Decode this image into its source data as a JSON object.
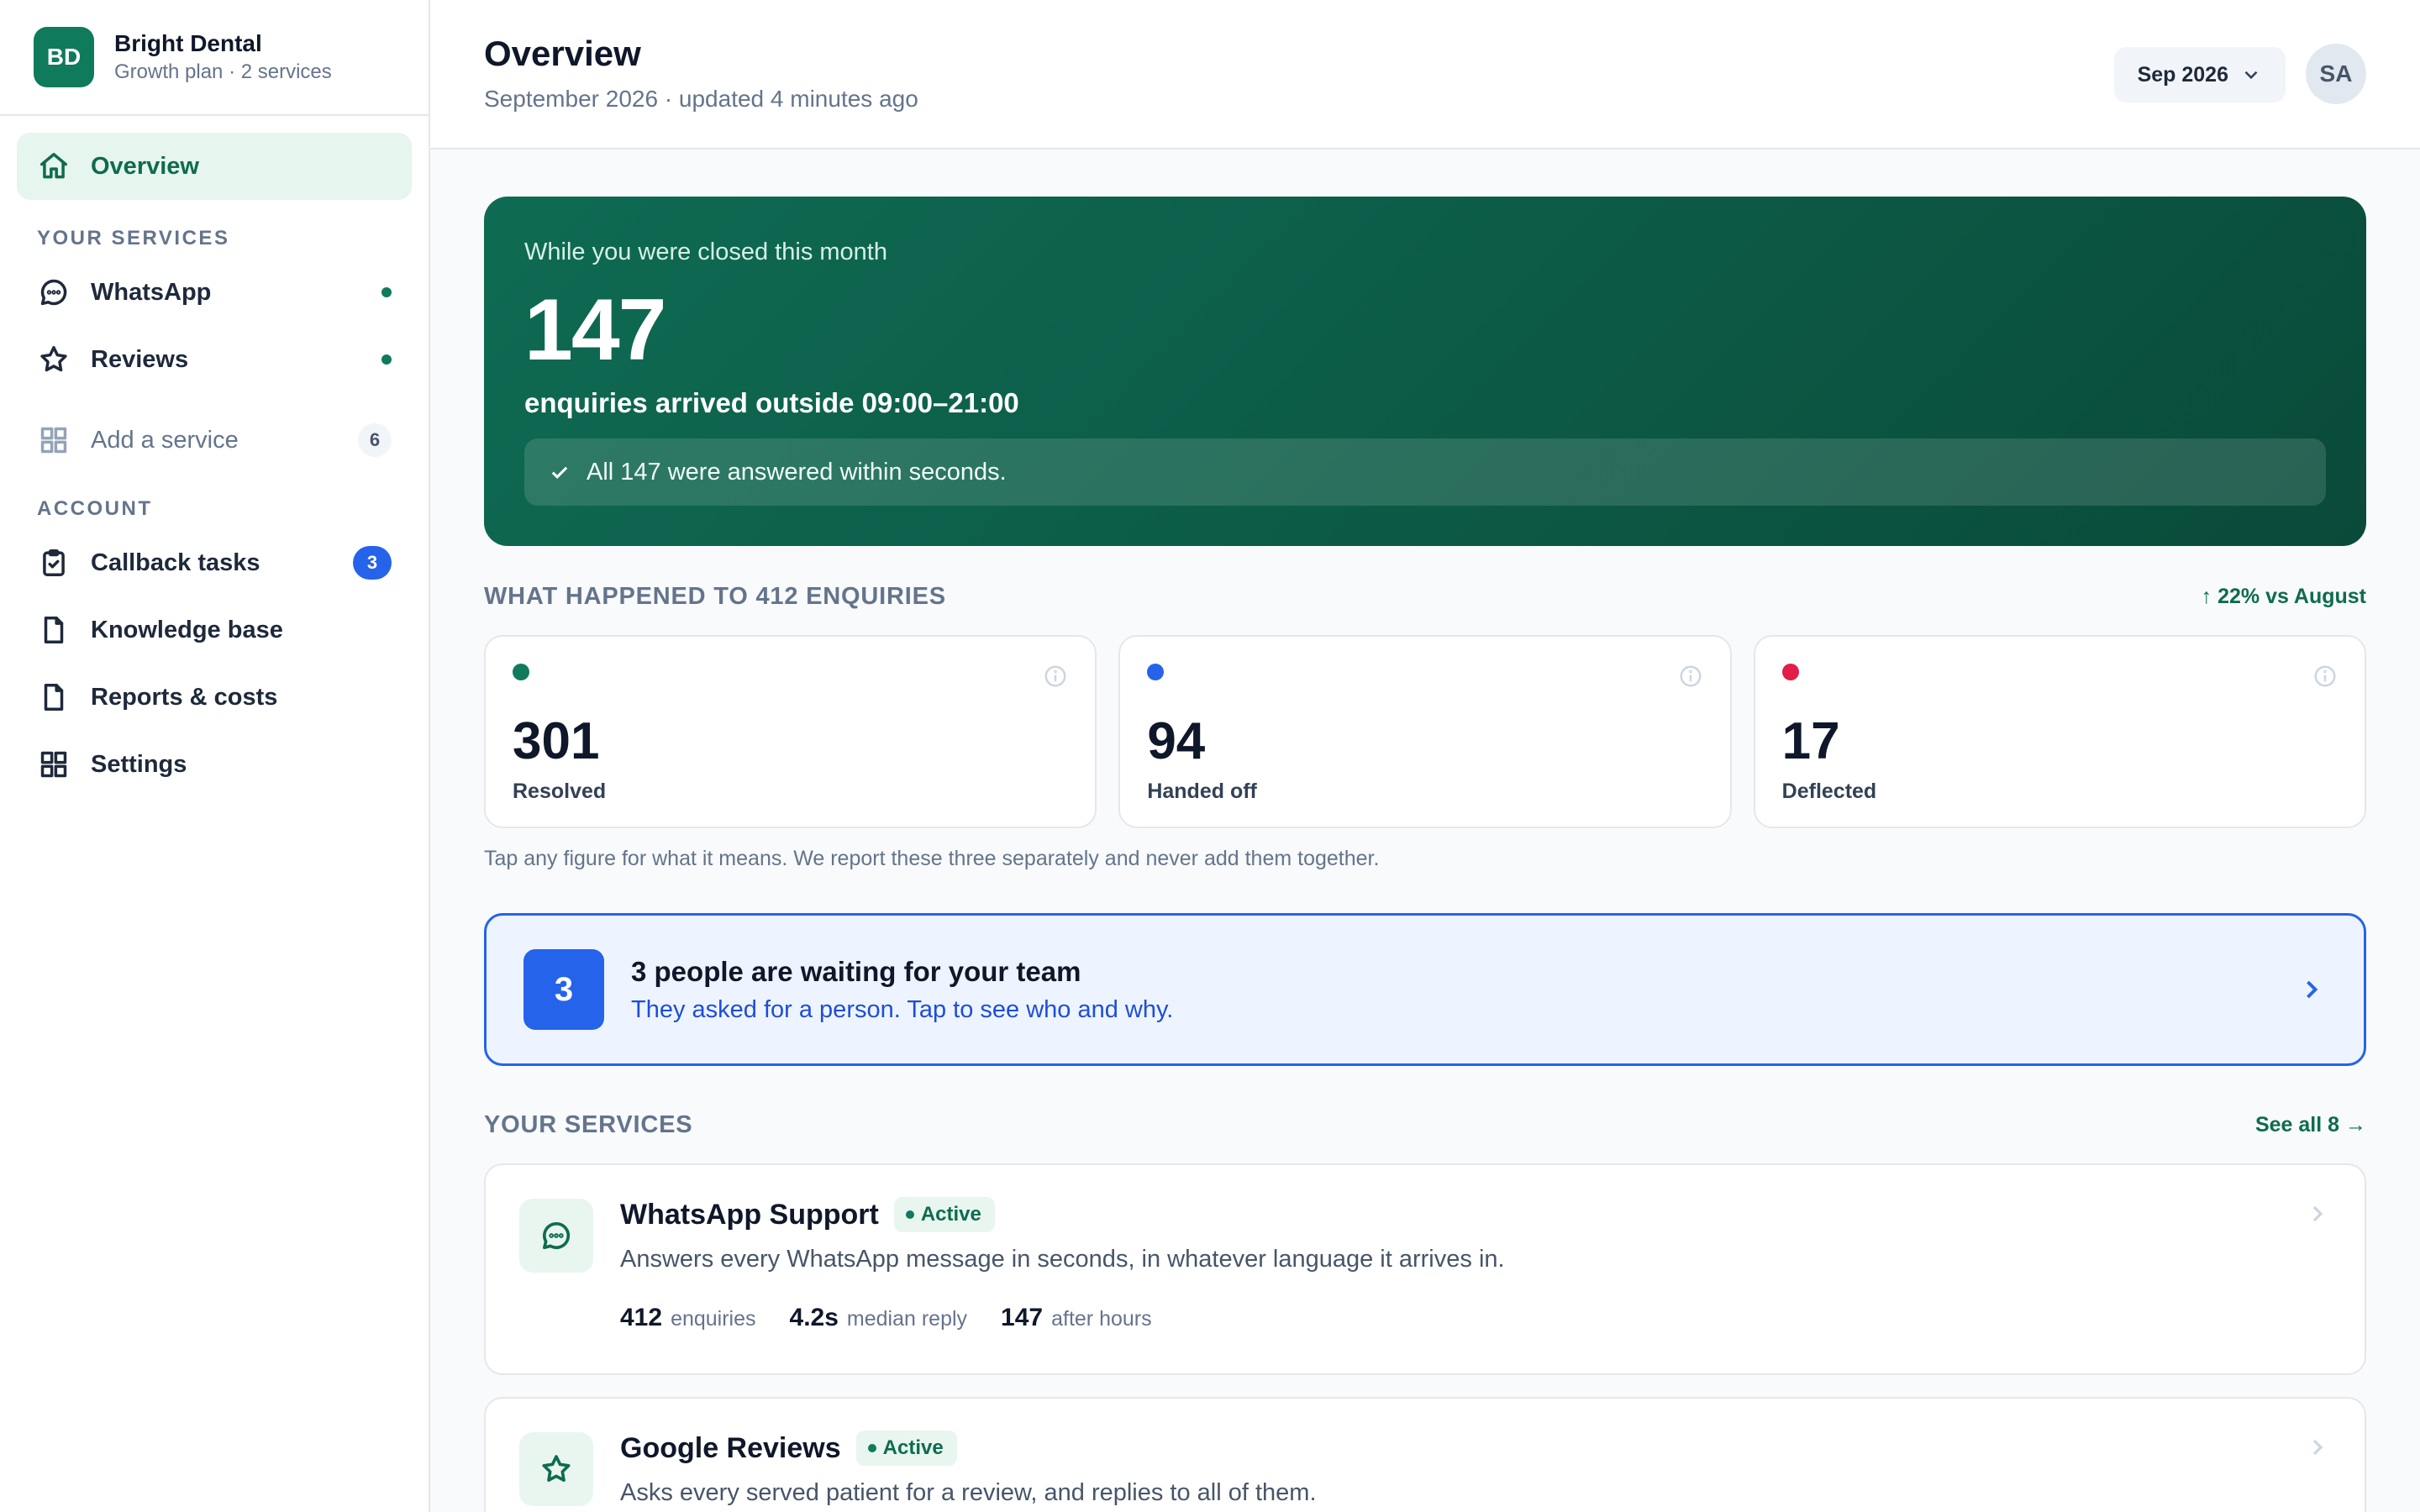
{
  "brand": {
    "initials": "BD",
    "name": "Bright Dental",
    "plan": "Growth plan · 2 services",
    "color": "#0f7a5c"
  },
  "sidebar": {
    "overview": "Overview",
    "services_label": "YOUR SERVICES",
    "services": [
      {
        "label": "WhatsApp",
        "icon": "chat-icon",
        "status": "active"
      },
      {
        "label": "Reviews",
        "icon": "star-icon",
        "status": "active"
      }
    ],
    "add_service": {
      "label": "Add a service",
      "count": "6"
    },
    "account_label": "ACCOUNT",
    "account": [
      {
        "label": "Callback tasks",
        "icon": "clipboard-icon",
        "badge": "3"
      },
      {
        "label": "Knowledge base",
        "icon": "document-icon"
      },
      {
        "label": "Reports & costs",
        "icon": "document-icon"
      },
      {
        "label": "Settings",
        "icon": "grid-icon"
      }
    ]
  },
  "header": {
    "title": "Overview",
    "subtitle": "September 2026 · updated 4 minutes ago",
    "month": "Sep 2026",
    "avatar": "SA"
  },
  "hero": {
    "kicker": "While you were closed this month",
    "number": "147",
    "description": "enquiries arrived outside 09:00–21:00",
    "note": "All 147 were answered within seconds."
  },
  "enquiries": {
    "title": "WHAT HAPPENED TO 412 ENQUIRIES",
    "trend": "↑ 22% vs August",
    "stats": [
      {
        "value": "301",
        "label": "Resolved",
        "color": "#0f7a5c"
      },
      {
        "value": "94",
        "label": "Handed off",
        "color": "#2563eb"
      },
      {
        "value": "17",
        "label": "Deflected",
        "color": "#e11d48"
      }
    ],
    "note": "Tap any figure for what it means. We report these three separately and never add them together."
  },
  "waiting": {
    "count": "3",
    "title": "3 people are waiting for your team",
    "subtitle": "They asked for a person. Tap to see who and why."
  },
  "services": {
    "title": "YOUR SERVICES",
    "see_all": "See all 8 →",
    "items": [
      {
        "name": "WhatsApp Support",
        "status": "Active",
        "description": "Answers every WhatsApp message in seconds, in whatever language it arrives in.",
        "metrics": [
          {
            "value": "412",
            "label": "enquiries"
          },
          {
            "value": "4.2s",
            "label": "median reply"
          },
          {
            "value": "147",
            "label": "after hours"
          }
        ]
      },
      {
        "name": "Google Reviews",
        "status": "Active",
        "description": "Asks every served patient for a review, and replies to all of them."
      }
    ]
  }
}
